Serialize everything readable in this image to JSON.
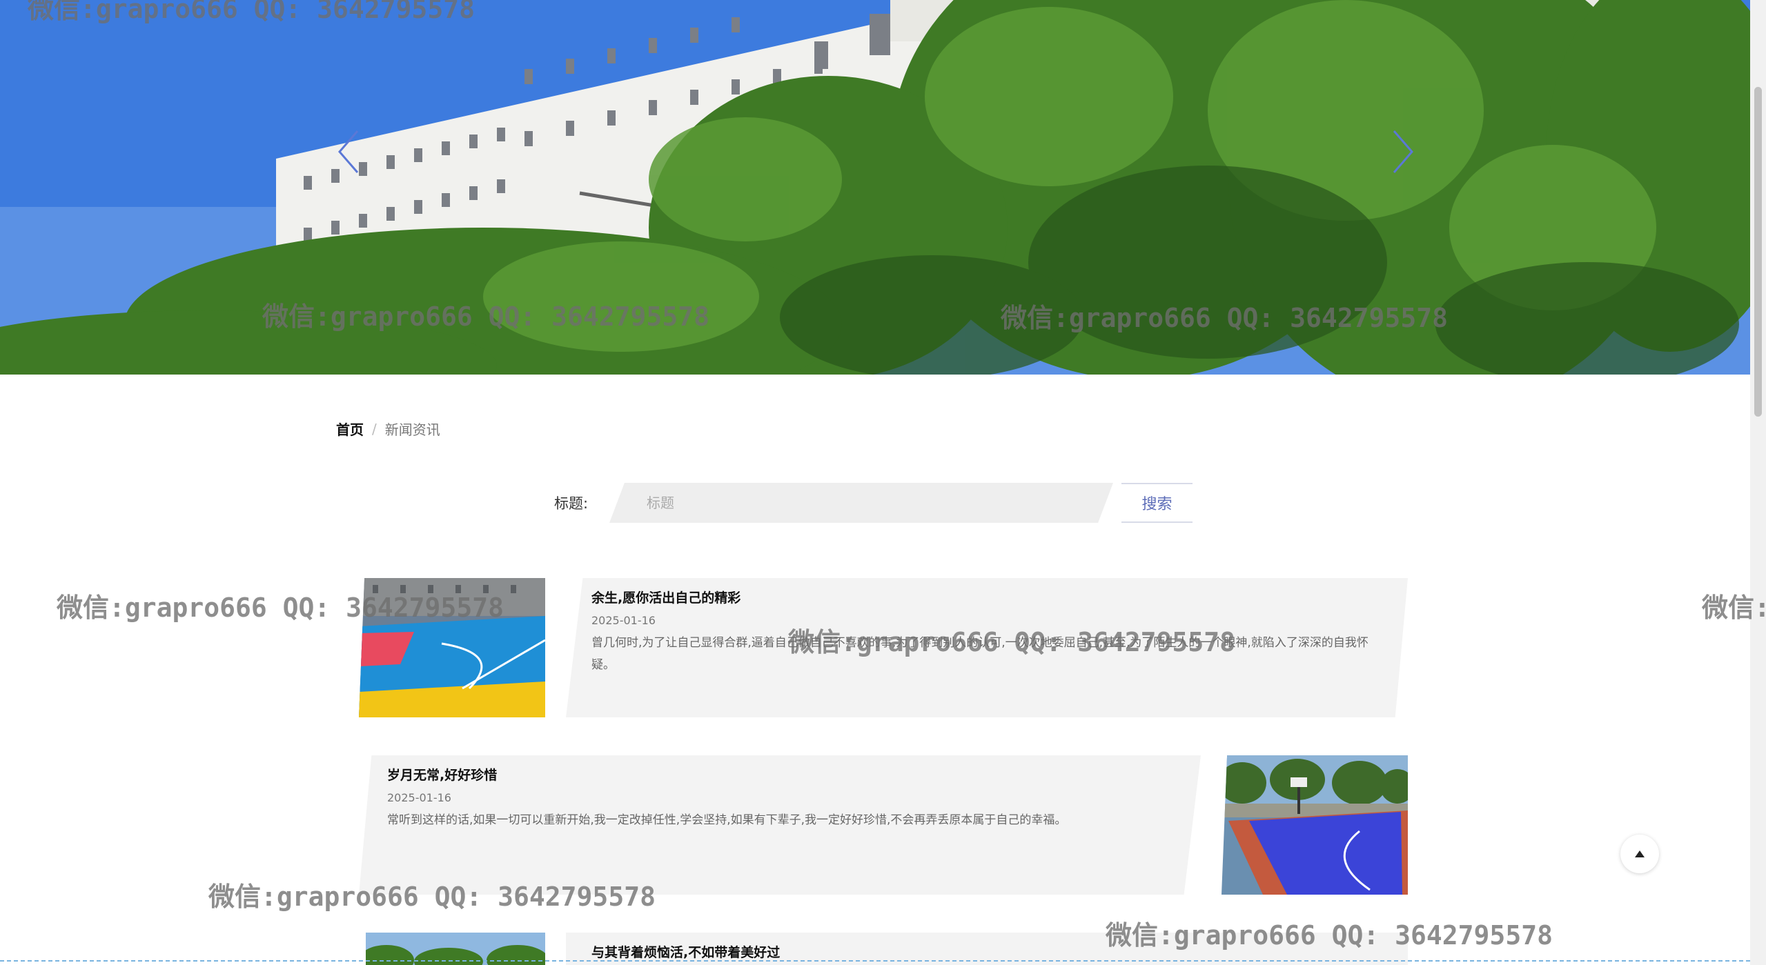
{
  "breadcrumb": {
    "home": "首页",
    "separator": "/",
    "current": "新闻资讯"
  },
  "search": {
    "label": "标题:",
    "placeholder": "标题",
    "button": "搜索"
  },
  "news": [
    {
      "title": "余生,愿你活出自己的精彩",
      "date": "2025-01-16",
      "summary": "曾几何时,为了让自己显得合群,逼着自己做自己不喜欢的事,为了得到别人的认可,一次次地委屈自己,甚至,为了陌生人的一个眼神,就陷入了深深的自我怀疑。"
    },
    {
      "title": "岁月无常,好好珍惜",
      "date": "2025-01-16",
      "summary": "常听到这样的话,如果一切可以重新开始,我一定改掉任性,学会坚持,如果有下辈子,我一定好好珍惜,不会再弄丢原本属于自己的幸福。"
    },
    {
      "title": "与其背着烦恼活,不如带着美好过",
      "date": "",
      "summary": ""
    }
  ],
  "watermark": "微信:grapro666 QQ: 3642795578",
  "icons": {
    "prev": "chevron-left-icon",
    "next": "chevron-right-icon",
    "back_to_top": "triangle-up-icon"
  },
  "colors": {
    "accent": "#5d6db8",
    "card_bg": "#f3f3f3"
  }
}
